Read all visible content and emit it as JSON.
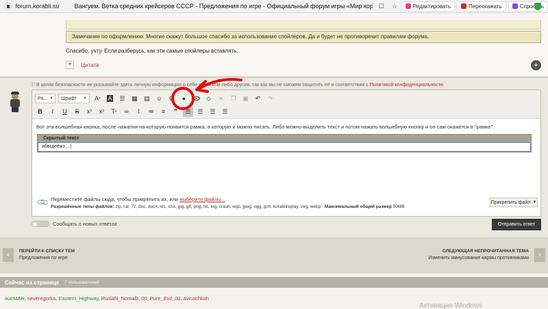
{
  "browser": {
    "domain": "forum.korabli.su",
    "title": "Вангуем. Ветка средних крейсеров СССР - Предложения по игре - Официальный форум игры «Мир кораблей»",
    "edit_label": "Редактировать",
    "retell_label": "Перескажать",
    "ask_label": "Спросить"
  },
  "post": {
    "moderator_note": "Замечание по оформлению. Многие скажут большое спасибо за использование спойлеров. Да и будет не противоречит правилам форума.",
    "reply_text": "Спасибо, учту. Если разберусь, как эти самые спойлеры вставлять.",
    "quote_label": "Цитата"
  },
  "reply": {
    "privacy_text": "В целях безопасности не указывайте здесь личную информацию о себе или о ком-либо другом, так как мы не сможем защитить её в соответствии с",
    "privacy_link": "Политикой конфиденциальности.",
    "toolbar": {
      "paragraph_select": "Ра...",
      "font_select": "Шрифт"
    },
    "editor_text": "Вот эта волшебная кнопка, после нажатия на которую появится рамка, в которую и можно писать. Либо можно выделить текст и потом нажать волшебную кнопку и он сам окажется в \"рамке\".",
    "hidden_title": "Скрытый текст",
    "hidden_content": "абвгдеёжз....|",
    "attach_text": "Переместите файлы сюда, чтобы прикрепить их, или",
    "attach_link": "выберите файлы...",
    "allowed_label": "Разрешённые типы файлов:",
    "allowed_types": "zip, rar, 7z, doc, docx, xls, xlsx, jpg, gif, png, txt, log, crash, wgc, jpeg, ogg, gch, korablireplay, svg, webp ·",
    "max_label": "Максимальный общий размер",
    "max_size": "50MB",
    "attach_button": "Прикрепить файл",
    "subscribe_label": "Сообщать о новых ответах",
    "send_button": "Отправить ответ"
  },
  "nav": {
    "prev_title": "ПЕРЕЙТИ К СПИСКУ ТЕМ",
    "prev_sub": "Предложения по игре",
    "next_title": "СЛЕДУЮЩАЯ НЕПРОЧИТАННАЯ ТЕМА",
    "next_sub": "Изменить минусование кармы противниками"
  },
  "online": {
    "title": "Сейчас на странице",
    "count": "7 пользователей",
    "users": [
      "aucMAH",
      "severegorka",
      "Eastern_Highway",
      "RuslaN_NomaD",
      "00_Pure_Evil_00",
      "avicachkoh"
    ],
    "watermark": "Активация Windows"
  },
  "annotation_color": "#e01010"
}
